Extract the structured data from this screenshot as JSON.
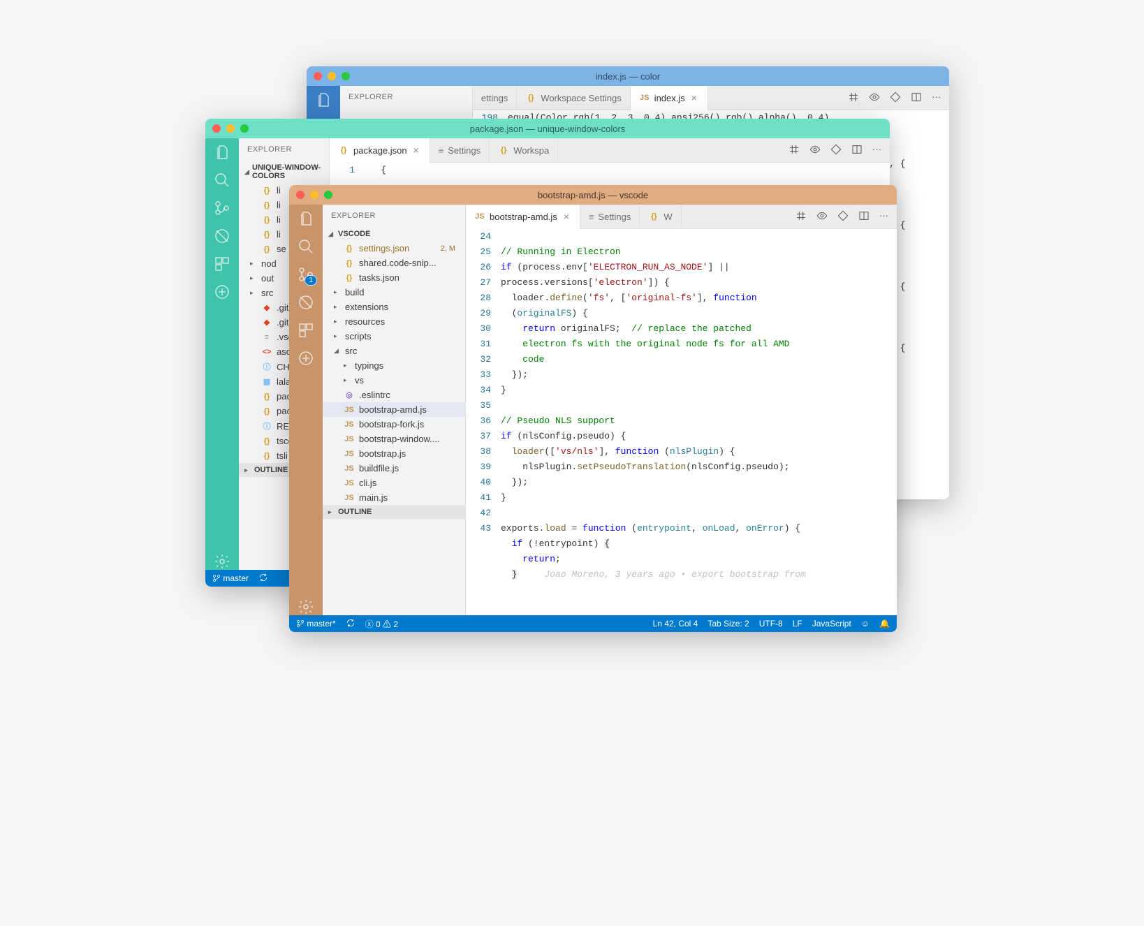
{
  "windows": {
    "w1": {
      "title": "index.js — color",
      "explorer_label": "EXPLORER",
      "tabs": [
        {
          "label": "ettings"
        },
        {
          "label": "Workspace Settings"
        },
        {
          "label": "index.js"
        }
      ],
      "code_line_num": "198",
      "code_line": "equal(Color.rgb(1, 2, 3, 0.4).ansi256().rgb().alpha(), 0.4)"
    },
    "w2": {
      "title": "package.json — unique-window-colors",
      "explorer_label": "EXPLORER",
      "section": "UNIQUE-WINDOW-COLORS",
      "tabs": [
        {
          "label": "package.json"
        },
        {
          "label": "Settings"
        },
        {
          "label": "Workspa"
        }
      ],
      "outline_label": "OUTLINE",
      "statusbar": {
        "branch": "master"
      },
      "files": [
        {
          "icon": "json",
          "name": "li"
        },
        {
          "icon": "json",
          "name": "li"
        },
        {
          "icon": "json",
          "name": "li"
        },
        {
          "icon": "json",
          "name": "li"
        },
        {
          "icon": "json",
          "name": "se"
        },
        {
          "icon": "folder",
          "name": "nod"
        },
        {
          "icon": "folder",
          "name": "out"
        },
        {
          "icon": "folder",
          "name": "src"
        },
        {
          "icon": "git",
          "name": ".gita"
        },
        {
          "icon": "git",
          "name": ".giti"
        },
        {
          "icon": "txt",
          "name": ".vsc"
        },
        {
          "icon": "html",
          "name": "asd"
        },
        {
          "icon": "info",
          "name": "CHA"
        },
        {
          "icon": "img",
          "name": "lala"
        },
        {
          "icon": "json",
          "name": "pac"
        },
        {
          "icon": "json",
          "name": "pac"
        },
        {
          "icon": "info",
          "name": "REA"
        },
        {
          "icon": "json",
          "name": "tsco"
        },
        {
          "icon": "json",
          "name": "tsli"
        }
      ],
      "code_first_line": "1",
      "code_first_content": "{"
    },
    "w3": {
      "title": "bootstrap-amd.js — vscode",
      "explorer_label": "EXPLORER",
      "section": "VSCODE",
      "tabs": [
        {
          "label": "bootstrap-amd.js"
        },
        {
          "label": "Settings"
        },
        {
          "label": "W"
        }
      ],
      "outline_label": "OUTLINE",
      "scm_badge": "1",
      "tree": [
        {
          "type": "file",
          "icon": "json",
          "name": "settings.json",
          "suffix": "2, M",
          "modified": true,
          "indent": 1
        },
        {
          "type": "file",
          "icon": "json",
          "name": "shared.code-snip...",
          "indent": 1
        },
        {
          "type": "file",
          "icon": "json",
          "name": "tasks.json",
          "indent": 1
        },
        {
          "type": "folder",
          "open": false,
          "name": "build",
          "indent": 0
        },
        {
          "type": "folder",
          "open": false,
          "name": "extensions",
          "indent": 0
        },
        {
          "type": "folder",
          "open": false,
          "name": "resources",
          "indent": 0
        },
        {
          "type": "folder",
          "open": false,
          "name": "scripts",
          "indent": 0
        },
        {
          "type": "folder",
          "open": true,
          "name": "src",
          "indent": 0
        },
        {
          "type": "folder",
          "open": false,
          "name": "typings",
          "indent": 1
        },
        {
          "type": "folder",
          "open": false,
          "name": "vs",
          "indent": 1
        },
        {
          "type": "file",
          "icon": "purple",
          "name": ".eslintrc",
          "indent": 1
        },
        {
          "type": "file",
          "icon": "js",
          "name": "bootstrap-amd.js",
          "indent": 1,
          "selected": true
        },
        {
          "type": "file",
          "icon": "js",
          "name": "bootstrap-fork.js",
          "indent": 1
        },
        {
          "type": "file",
          "icon": "js",
          "name": "bootstrap-window....",
          "indent": 1
        },
        {
          "type": "file",
          "icon": "js",
          "name": "bootstrap.js",
          "indent": 1
        },
        {
          "type": "file",
          "icon": "js",
          "name": "buildfile.js",
          "indent": 1
        },
        {
          "type": "file",
          "icon": "js",
          "name": "cli.js",
          "indent": 1
        },
        {
          "type": "file",
          "icon": "js",
          "name": "main.js",
          "indent": 1
        }
      ],
      "code_lines": [
        24,
        25,
        26,
        27,
        28,
        29,
        30,
        31,
        32,
        33,
        34,
        35,
        36,
        37,
        38,
        39,
        40,
        41,
        42,
        43
      ],
      "annotation": "Joao Moreno, 3 years ago • export bootstrap from",
      "statusbar": {
        "branch": "master*",
        "errors": "0",
        "warnings": "2",
        "position": "Ln 42, Col 4",
        "tab_size": "Tab Size: 2",
        "encoding": "UTF-8",
        "eol": "LF",
        "language": "JavaScript"
      }
    }
  }
}
